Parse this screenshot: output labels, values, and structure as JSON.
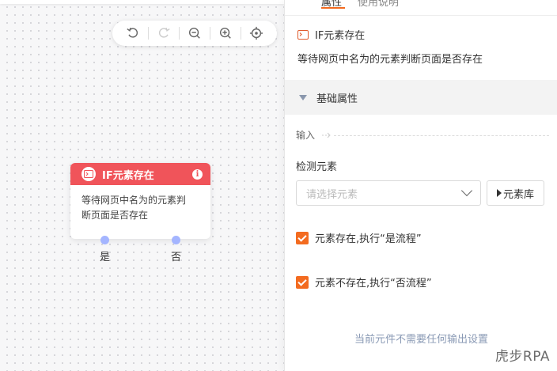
{
  "toolbar": {
    "icons": [
      "undo-icon",
      "redo-icon",
      "zoom-out-icon",
      "zoom-in-icon",
      "locate-icon"
    ]
  },
  "node": {
    "title": "IF元素存在",
    "description_line1": "等待网页中名为的元素判",
    "description_line2": "断页面是否存在",
    "port_yes": "是",
    "port_no": "否",
    "header_color": "#f0545a"
  },
  "panel": {
    "tabs": [
      "属性",
      "使用说明"
    ],
    "component_title": "IF元素存在",
    "component_description": "等待网页中名为的元素判断页面是否存在",
    "section_title": "基础属性",
    "input_label": "输入",
    "detect_label": "检测元素",
    "select_placeholder": "请选择元素",
    "library_button": "元素库",
    "check_exists_label": "元素存在,执行“是流程”",
    "check_not_exists_label": "元素不存在,执行“否流程”",
    "no_output_text": "当前元件不需要任何输出设置",
    "accent_color": "#f36b20"
  },
  "watermark": "虎步RPA"
}
